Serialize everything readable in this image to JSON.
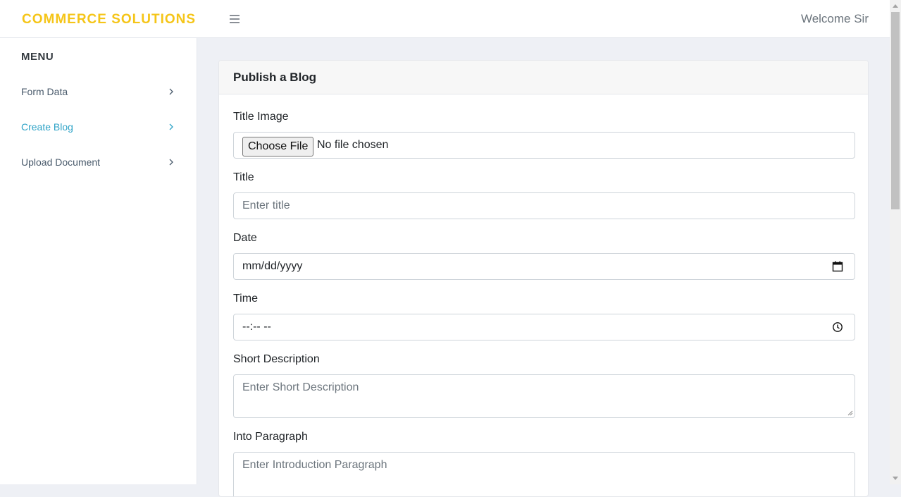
{
  "header": {
    "brand": "COMMERCE SOLUTIONS",
    "welcome": "Welcome Sir"
  },
  "sidebar": {
    "menu_title": "MENU",
    "items": [
      {
        "label": "Form Data",
        "active": false
      },
      {
        "label": "Create Blog",
        "active": true
      },
      {
        "label": "Upload Document",
        "active": false
      }
    ]
  },
  "form": {
    "title": "Publish a Blog",
    "title_image": {
      "label": "Title Image",
      "button": "Choose File",
      "status": "No file chosen"
    },
    "title_field": {
      "label": "Title",
      "placeholder": "Enter title"
    },
    "date_field": {
      "label": "Date",
      "value": "mm/dd/yyyy",
      "icon": "calendar-icon"
    },
    "time_field": {
      "label": "Time",
      "value": "--:-- --",
      "icon": "clock-icon"
    },
    "short_description": {
      "label": "Short Description",
      "placeholder": "Enter Short Description"
    },
    "intro_paragraph": {
      "label": "Into Paragraph",
      "placeholder": "Enter Introduction Paragraph"
    }
  },
  "colors": {
    "brand": "#f5c518",
    "active_link": "#2ea3c7",
    "page_bg": "#eef0f5"
  }
}
